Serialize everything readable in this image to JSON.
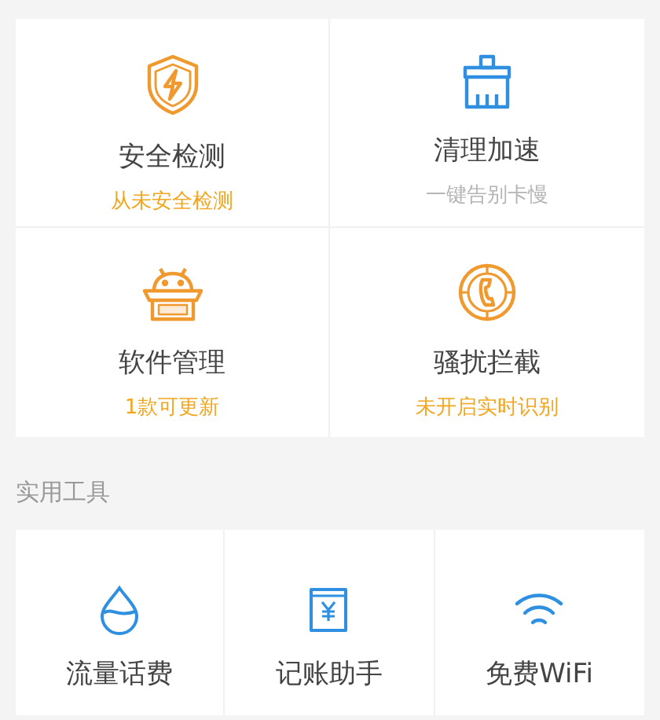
{
  "features": [
    {
      "kind": "shield",
      "title": "安全检测",
      "subtitle": "从未安全检测",
      "highlighted": true
    },
    {
      "kind": "brush",
      "title": "清理加速",
      "subtitle": "一键告别卡慢",
      "highlighted": false
    },
    {
      "kind": "android",
      "title": "软件管理",
      "subtitle": "1款可更新",
      "highlighted": true
    },
    {
      "kind": "block",
      "title": "骚扰拦截",
      "subtitle": "未开启实时识别",
      "highlighted": true
    }
  ],
  "tools_section": {
    "title": "实用工具"
  },
  "tools": [
    {
      "kind": "drop",
      "label": "流量话费"
    },
    {
      "kind": "receipt",
      "label": "记账助手"
    },
    {
      "kind": "wifi",
      "label": "免费WiFi"
    }
  ]
}
